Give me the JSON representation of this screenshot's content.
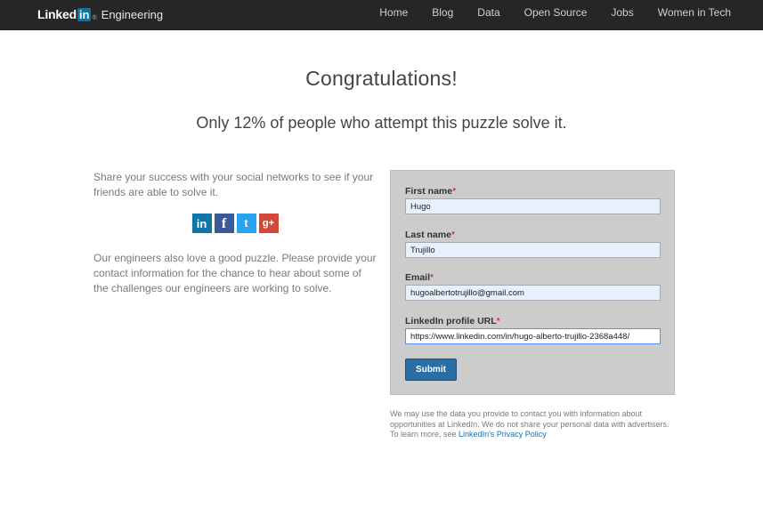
{
  "header": {
    "logo_text": "Linked",
    "logo_in": "in",
    "logo_reg": "®",
    "logo_sub": "Engineering",
    "nav": [
      "Home",
      "Blog",
      "Data",
      "Open Source",
      "Jobs",
      "Women in Tech"
    ]
  },
  "main": {
    "headline": "Congratulations!",
    "subheadline": "Only 12% of people who attempt this puzzle solve it.",
    "share_text": "Share your success with your social networks to see if your friends are able to solve it.",
    "social": [
      {
        "icon": "linkedin-icon",
        "glyph": "in"
      },
      {
        "icon": "facebook-icon",
        "glyph": "f"
      },
      {
        "icon": "twitter-icon",
        "glyph": "t"
      },
      {
        "icon": "google-plus-icon",
        "glyph": "g+"
      }
    ],
    "puzzle_text": "Our engineers also love a good puzzle. Please provide your contact information for the chance to hear about some of the challenges our engineers are working to solve."
  },
  "form": {
    "first_name": {
      "label": "First name",
      "value": "Hugo"
    },
    "last_name": {
      "label": "Last name",
      "value": "Trujillo"
    },
    "email": {
      "label": "Email",
      "value": "hugoalbertotrujillo@gmail.com"
    },
    "linkedin_url": {
      "label": "LinkedIn profile URL",
      "value": "https://www.linkedin.com/in/hugo-alberto-trujillo-2368a448/"
    },
    "required_mark": "*",
    "submit_label": "Submit"
  },
  "disclaimer": {
    "text": "We may use the data you provide to contact you with information about opportunities at LinkedIn. We do not share your personal data with advertisers. To learn more, see ",
    "link_text": "LinkedIn's Privacy Policy"
  },
  "colors": {
    "topbar": "#262626",
    "linkedin_blue": "#0077b5",
    "form_bg": "#cccccc",
    "submit_bg": "#2b6ea6",
    "link": "#1a6fb0"
  }
}
